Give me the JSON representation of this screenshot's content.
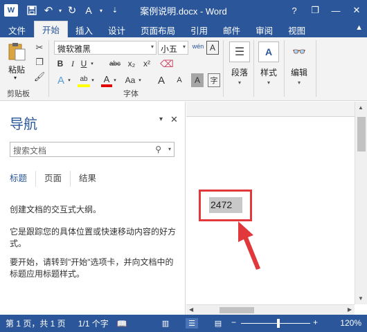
{
  "titlebar": {
    "title": "案例说明.docx - Word",
    "app_icon_label": "W",
    "controls": {
      "help": "?",
      "restore": "❐",
      "minimize": "—",
      "close": "✕"
    }
  },
  "ribbon_tabs": [
    "文件",
    "开始",
    "插入",
    "设计",
    "页面布局",
    "引用",
    "邮件",
    "审阅",
    "视图"
  ],
  "active_tab": "开始",
  "clipboard": {
    "paste_label": "粘贴",
    "group_label": "剪贴板"
  },
  "font": {
    "name": "微软雅黑",
    "size": "小五",
    "group_label": "字体",
    "buttons": {
      "bold": "B",
      "italic": "I",
      "underline": "U",
      "strike": "abc",
      "subscript": "x₂",
      "superscript": "x²",
      "text_effect": "A",
      "highlight": "ab",
      "font_color": "A",
      "case": "Aa",
      "grow": "A",
      "shrink": "A",
      "shading": "A",
      "wen": "wén",
      "border_char": "A"
    }
  },
  "paragraph": {
    "label": "段落"
  },
  "styles": {
    "label": "样式"
  },
  "editing": {
    "label": "编辑"
  },
  "nav": {
    "title": "导航",
    "search_placeholder": "搜索文档",
    "tabs": [
      "标题",
      "页面",
      "结果"
    ],
    "active_tab": "标题",
    "paragraphs": [
      "创建文档的交互式大纲。",
      "它是跟踪您的具体位置或快速移动内容的好方式。",
      "要开始，请转到\"开始\"选项卡，并向文档中的标题应用标题样式。"
    ]
  },
  "document": {
    "highlighted_text": "2472"
  },
  "status": {
    "page": "第 1 页，共 1 页",
    "words": "1/1 个字",
    "zoom": "120%",
    "zoom_level_percent": 120
  },
  "colors": {
    "brand": "#2b579a",
    "annotation": "#e0383b",
    "highlight": "#c8c8c8"
  }
}
